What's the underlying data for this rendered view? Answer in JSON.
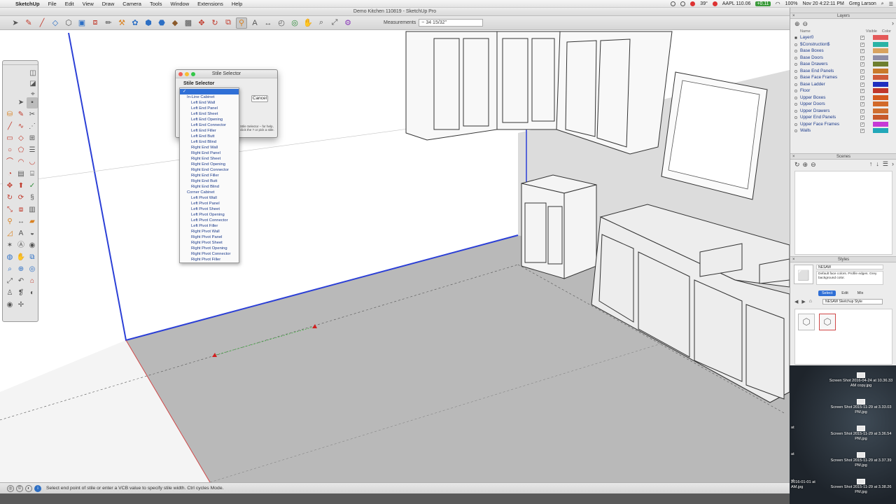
{
  "menubar": {
    "app": "SketchUp",
    "items": [
      "File",
      "Edit",
      "View",
      "Draw",
      "Camera",
      "Tools",
      "Window",
      "Extensions",
      "Help"
    ],
    "temperature": "39°",
    "stock": "AAPL 110.06",
    "stock_change": "+0.11",
    "battery": "100%",
    "datetime": "Nov 20 4:22:11 PM",
    "user": "Greg Larson"
  },
  "window": {
    "title": "Demo Kitchen 110819 - SketchUp Pro"
  },
  "toolbar": {
    "measurements_label": "Measurements",
    "measurements_value": "~ 34 15/32\""
  },
  "dialog": {
    "title": "Stile Selector",
    "label": "Stile Selector",
    "cancel": "Cancel",
    "note": "Stile Selector – for help, click the ? or pick a stile."
  },
  "stile_list": {
    "selected": "✓",
    "items": [
      {
        "label": "In-Line Cabinet",
        "group": true
      },
      {
        "label": "Left End Wall"
      },
      {
        "label": "Left End Panel"
      },
      {
        "label": "Left End Sheet"
      },
      {
        "label": "Left End Opening"
      },
      {
        "label": "Left End Connector"
      },
      {
        "label": "Left End Filler"
      },
      {
        "label": "Left End Butt"
      },
      {
        "label": "Left End Blind"
      },
      {
        "label": "Right End Wall"
      },
      {
        "label": "Right End Panel"
      },
      {
        "label": "Right End Sheet"
      },
      {
        "label": "Right End Opening"
      },
      {
        "label": "Right End Connector"
      },
      {
        "label": "Right End Filler"
      },
      {
        "label": "Right End Butt"
      },
      {
        "label": "Right End Blind"
      },
      {
        "label": "Corner Cabinet",
        "group": true
      },
      {
        "label": "Left Pivot Wall"
      },
      {
        "label": "Left Pivot Panel"
      },
      {
        "label": "Left Pivot Sheet"
      },
      {
        "label": "Left Pivot Opening"
      },
      {
        "label": "Left Pivot Connector"
      },
      {
        "label": "Left Pivot Filler"
      },
      {
        "label": "Right Pivot Wall"
      },
      {
        "label": "Right Pivot Panel"
      },
      {
        "label": "Right Pivot Sheet"
      },
      {
        "label": "Right Pivot Opening"
      },
      {
        "label": "Right Pivot Connector"
      },
      {
        "label": "Right Pivot Filler"
      }
    ]
  },
  "status": {
    "text": "Select end point of stile or enter a VCB value to specify stile width. Ctrl cycles Mode."
  },
  "layers_panel": {
    "title": "Layers",
    "col_name": "Name",
    "col_visible": "Visible",
    "col_color": "Color",
    "rows": [
      {
        "name": "Layer0",
        "color": "#e45a5a",
        "active": true
      },
      {
        "name": "$Construction$",
        "color": "#2ab3a5"
      },
      {
        "name": "Base Boxes",
        "color": "#d8a25f"
      },
      {
        "name": "Base Doors",
        "color": "#8e8ea8"
      },
      {
        "name": "Base Drawers",
        "color": "#6f7f2f"
      },
      {
        "name": "Base End Panels",
        "color": "#c97a2b"
      },
      {
        "name": "Base Face Frames",
        "color": "#cf5b3a"
      },
      {
        "name": "Base Ladder",
        "color": "#1f2fbf"
      },
      {
        "name": "Floor",
        "color": "#c0382b"
      },
      {
        "name": "Upper Boxes",
        "color": "#d45a1e"
      },
      {
        "name": "Upper Doors",
        "color": "#d26a2a"
      },
      {
        "name": "Upper Drawers",
        "color": "#cf6f30"
      },
      {
        "name": "Upper End Panels",
        "color": "#c75a2b"
      },
      {
        "name": "Upper Face Frames",
        "color": "#c63ad6"
      },
      {
        "name": "Walls",
        "color": "#22a7b8"
      }
    ]
  },
  "scenes_panel": {
    "title": "Scenes"
  },
  "styles_panel": {
    "title": "Styles",
    "style_name": "NESAW",
    "description": "Default face colors. Profile edges. Grey background color.",
    "tab_select": "Select",
    "tab_edit": "Edit",
    "tab_mix": "Mix",
    "collection": "NESAW Sketchup Style"
  },
  "desktop": {
    "files": [
      {
        "name": "Screen Shot 2016-04-24 at 10.36.33 AM copy.jpg"
      },
      {
        "name": "Screen Shot 2015-11-29 at 3.33.03 PM.jpg"
      },
      {
        "name": "Screen Shot 2015-11-29 at 3.36.54 PM.jpg"
      },
      {
        "name": "Screen Shot 2015-11-29 at 3.37.39 PM.jpg"
      },
      {
        "name": "Screen Shot 2015-11-29 at 3.38.26 PM.jpg"
      }
    ],
    "side_labels": [
      "at",
      "at",
      "at",
      "at",
      "2016-01-01 at",
      "AM.jpg"
    ]
  }
}
